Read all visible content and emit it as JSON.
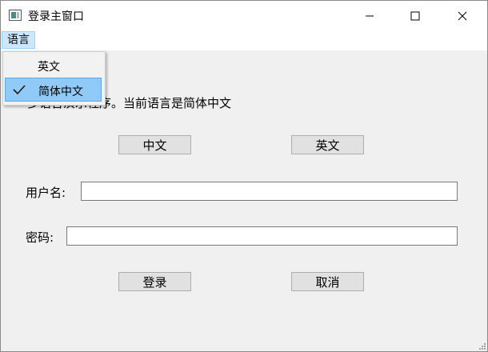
{
  "window": {
    "title": "登录主窗口",
    "icon": "window-app-icon",
    "controls": [
      "minimize-icon",
      "maximize-icon",
      "close-icon"
    ]
  },
  "menubar": {
    "language_menu": "语言"
  },
  "language_dropdown": {
    "items": [
      {
        "label": "英文",
        "checked": false
      },
      {
        "label": "简体中文",
        "checked": true
      }
    ]
  },
  "content": {
    "description": "多语言演示程序。当前语言是简体中文",
    "chinese_button": "中文",
    "english_button": "英文",
    "username_label": "用户名:",
    "username_value": "",
    "password_label": "密码:",
    "password_value": "",
    "login_button": "登录",
    "cancel_button": "取消"
  },
  "colors": {
    "menu_active_bg": "#cce8ff",
    "selected_item_bg": "#91c9f7",
    "window_bg": "#f0f0f0",
    "button_bg": "#e1e1e1"
  }
}
